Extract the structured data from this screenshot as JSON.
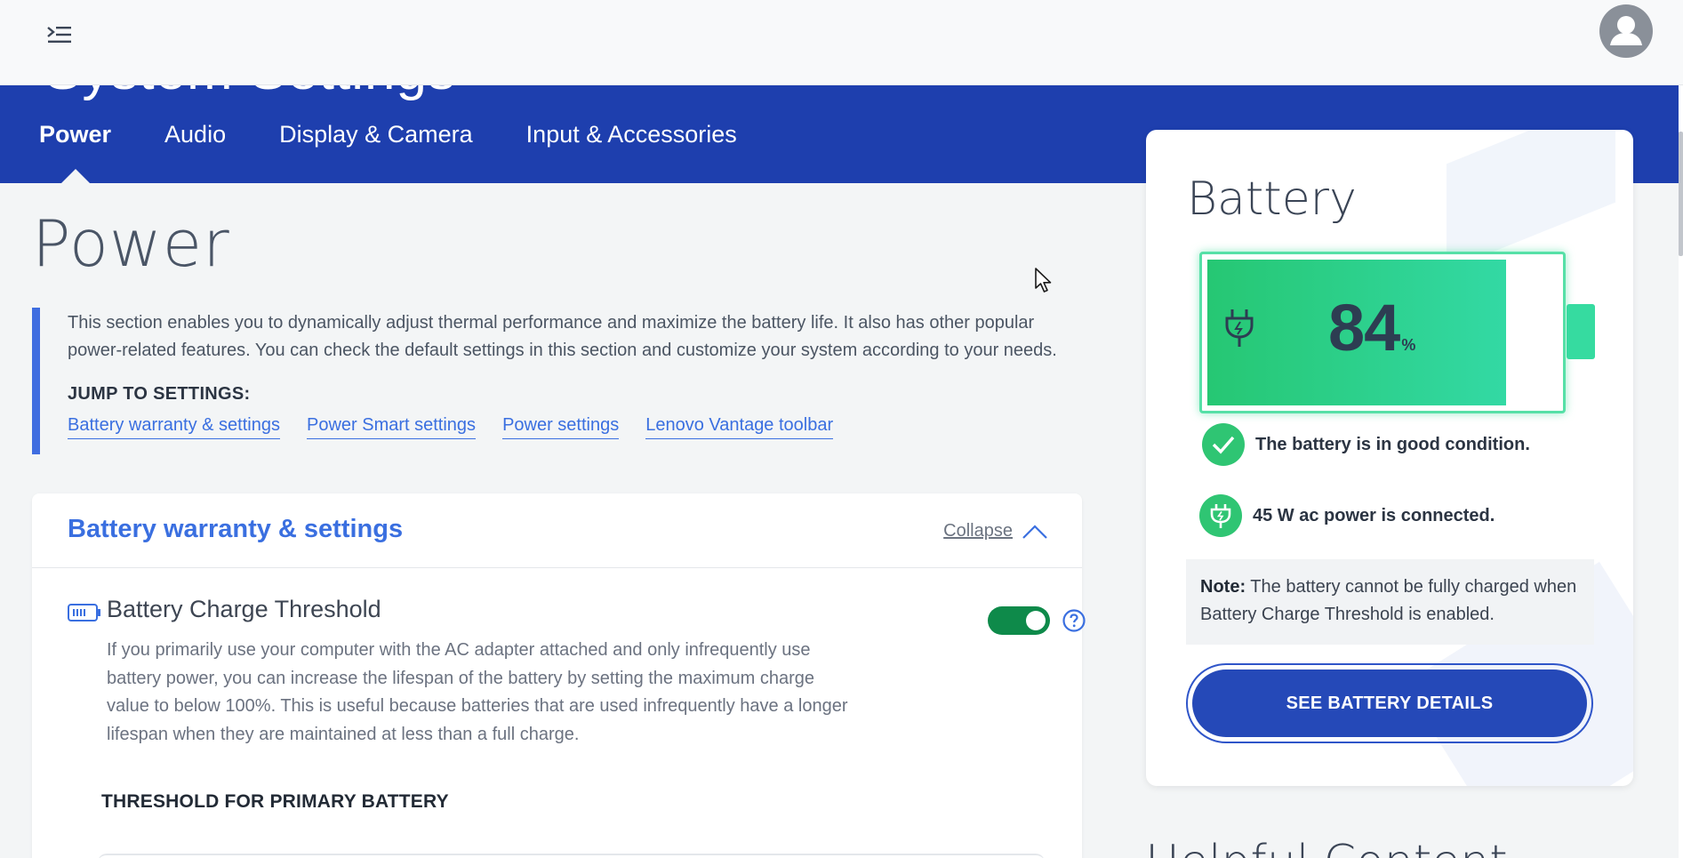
{
  "appbar": {
    "menu_icon": "menu-expand-icon",
    "avatar_icon": "user-avatar-icon"
  },
  "header": {
    "page_title_partial": "System Settings",
    "tabs": [
      {
        "label": "Power",
        "active": true
      },
      {
        "label": "Audio",
        "active": false
      },
      {
        "label": "Display & Camera",
        "active": false
      },
      {
        "label": "Input & Accessories",
        "active": false
      }
    ],
    "color": "#1e3fae"
  },
  "main": {
    "title": "Power",
    "intro": "This section enables you to dynamically adjust thermal performance and maximize the battery life. It also has other popular power-related features. You can check the default settings in this section and customize your system according to your needs.",
    "jump_label": "JUMP TO SETTINGS:",
    "jump_links": [
      "Battery warranty & settings",
      "Power Smart settings",
      "Power settings",
      "Lenovo Vantage toolbar"
    ]
  },
  "section": {
    "title": "Battery warranty & settings",
    "collapse_label": "Collapse",
    "setting": {
      "title": "Battery Charge Threshold",
      "description": "If you primarily use your computer with the AC adapter attached and only infrequently use battery power, you can increase the lifespan of the battery by setting the maximum charge value to below 100%. This is useful because batteries that are used infrequently have a longer lifespan when they are maintained at less than a full charge.",
      "toggle_on": true
    },
    "threshold_label": "THRESHOLD FOR PRIMARY BATTERY"
  },
  "battery": {
    "title": "Battery",
    "percent": "84",
    "percent_sign": "%",
    "level": 0.84,
    "condition": "The battery is in good condition.",
    "power": "45 W ac power is connected.",
    "note_label": "Note:",
    "note_text": " The battery cannot be fully charged when Battery Charge Threshold is enabled.",
    "details_button": "SEE BATTERY DETAILS",
    "fill_color": "#26c773"
  },
  "helpful": {
    "title": "Helpful Content"
  }
}
